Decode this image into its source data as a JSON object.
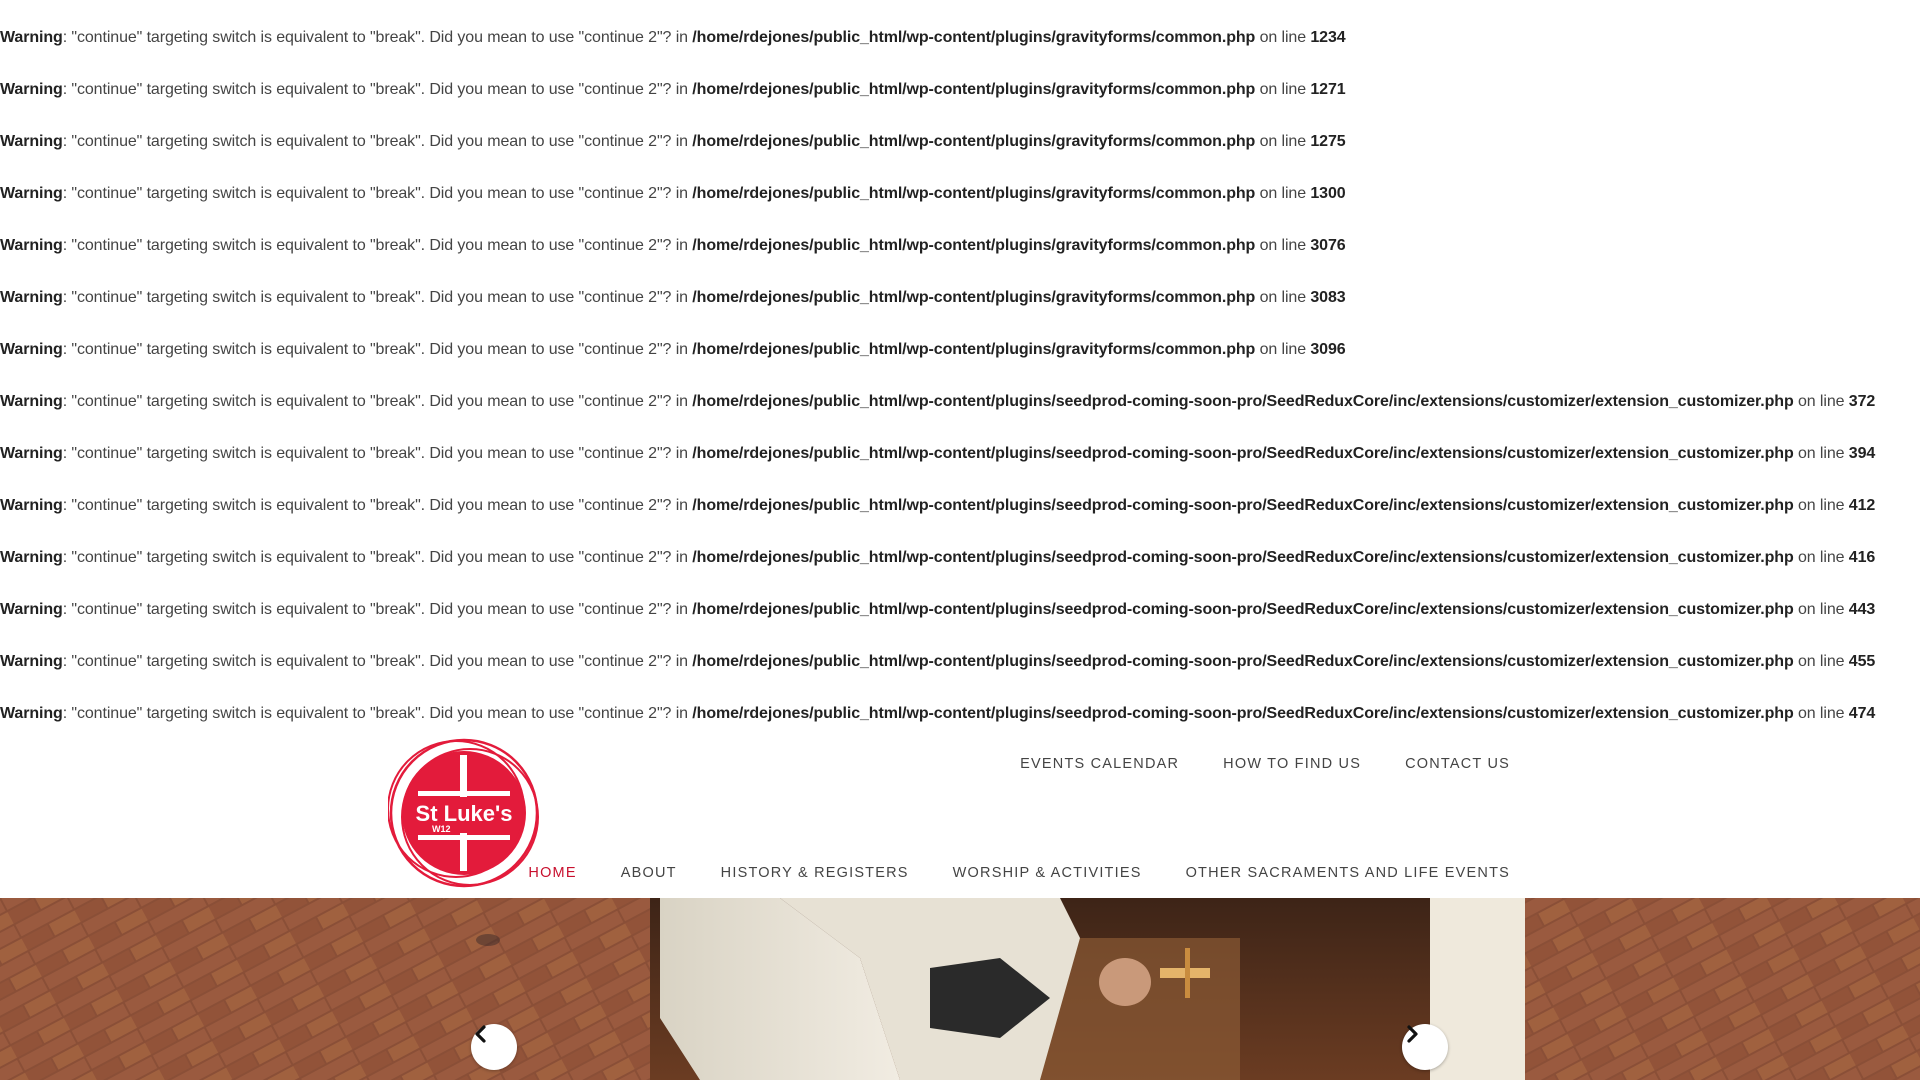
{
  "warnings": [
    {
      "label": "Warning",
      "message": ": \"continue\" targeting switch is equivalent to \"break\". Did you mean to use \"continue 2\"? in ",
      "file": "/home/rdejones/public_html/wp-content/plugins/gravityforms/common.php",
      "on_line": " on line ",
      "line": "1234"
    },
    {
      "label": "Warning",
      "message": ": \"continue\" targeting switch is equivalent to \"break\". Did you mean to use \"continue 2\"? in ",
      "file": "/home/rdejones/public_html/wp-content/plugins/gravityforms/common.php",
      "on_line": " on line ",
      "line": "1271"
    },
    {
      "label": "Warning",
      "message": ": \"continue\" targeting switch is equivalent to \"break\". Did you mean to use \"continue 2\"? in ",
      "file": "/home/rdejones/public_html/wp-content/plugins/gravityforms/common.php",
      "on_line": " on line ",
      "line": "1275"
    },
    {
      "label": "Warning",
      "message": ": \"continue\" targeting switch is equivalent to \"break\". Did you mean to use \"continue 2\"? in ",
      "file": "/home/rdejones/public_html/wp-content/plugins/gravityforms/common.php",
      "on_line": " on line ",
      "line": "1300"
    },
    {
      "label": "Warning",
      "message": ": \"continue\" targeting switch is equivalent to \"break\". Did you mean to use \"continue 2\"? in ",
      "file": "/home/rdejones/public_html/wp-content/plugins/gravityforms/common.php",
      "on_line": " on line ",
      "line": "3076"
    },
    {
      "label": "Warning",
      "message": ": \"continue\" targeting switch is equivalent to \"break\". Did you mean to use \"continue 2\"? in ",
      "file": "/home/rdejones/public_html/wp-content/plugins/gravityforms/common.php",
      "on_line": " on line ",
      "line": "3083"
    },
    {
      "label": "Warning",
      "message": ": \"continue\" targeting switch is equivalent to \"break\". Did you mean to use \"continue 2\"? in ",
      "file": "/home/rdejones/public_html/wp-content/plugins/gravityforms/common.php",
      "on_line": " on line ",
      "line": "3096"
    },
    {
      "label": "Warning",
      "message": ": \"continue\" targeting switch is equivalent to \"break\". Did you mean to use \"continue 2\"? in ",
      "file": "/home/rdejones/public_html/wp-content/plugins/seedprod-coming-soon-pro/SeedReduxCore/inc/extensions/customizer/extension_customizer.php",
      "on_line": " on line ",
      "line": "372"
    },
    {
      "label": "Warning",
      "message": ": \"continue\" targeting switch is equivalent to \"break\". Did you mean to use \"continue 2\"? in ",
      "file": "/home/rdejones/public_html/wp-content/plugins/seedprod-coming-soon-pro/SeedReduxCore/inc/extensions/customizer/extension_customizer.php",
      "on_line": " on line ",
      "line": "394"
    },
    {
      "label": "Warning",
      "message": ": \"continue\" targeting switch is equivalent to \"break\". Did you mean to use \"continue 2\"? in ",
      "file": "/home/rdejones/public_html/wp-content/plugins/seedprod-coming-soon-pro/SeedReduxCore/inc/extensions/customizer/extension_customizer.php",
      "on_line": " on line ",
      "line": "412"
    },
    {
      "label": "Warning",
      "message": ": \"continue\" targeting switch is equivalent to \"break\". Did you mean to use \"continue 2\"? in ",
      "file": "/home/rdejones/public_html/wp-content/plugins/seedprod-coming-soon-pro/SeedReduxCore/inc/extensions/customizer/extension_customizer.php",
      "on_line": " on line ",
      "line": "416"
    },
    {
      "label": "Warning",
      "message": ": \"continue\" targeting switch is equivalent to \"break\". Did you mean to use \"continue 2\"? in ",
      "file": "/home/rdejones/public_html/wp-content/plugins/seedprod-coming-soon-pro/SeedReduxCore/inc/extensions/customizer/extension_customizer.php",
      "on_line": " on line ",
      "line": "443"
    },
    {
      "label": "Warning",
      "message": ": \"continue\" targeting switch is equivalent to \"break\". Did you mean to use \"continue 2\"? in ",
      "file": "/home/rdejones/public_html/wp-content/plugins/seedprod-coming-soon-pro/SeedReduxCore/inc/extensions/customizer/extension_customizer.php",
      "on_line": " on line ",
      "line": "455"
    },
    {
      "label": "Warning",
      "message": ": \"continue\" targeting switch is equivalent to \"break\". Did you mean to use \"continue 2\"? in ",
      "file": "/home/rdejones/public_html/wp-content/plugins/seedprod-coming-soon-pro/SeedReduxCore/inc/extensions/customizer/extension_customizer.php",
      "on_line": " on line ",
      "line": "474"
    }
  ],
  "logo": {
    "text": "St Luke's",
    "subtext": "W12",
    "color": "#e31b3b",
    "icon": "st-lukes-logo"
  },
  "top_nav": {
    "events": "EVENTS CALENDAR",
    "find": "HOW TO FIND US",
    "contact": "CONTACT US"
  },
  "main_nav": {
    "home": "HOME",
    "about": "ABOUT",
    "history": "HISTORY & REGISTERS",
    "worship": "WORSHIP & ACTIVITIES",
    "sacraments": "OTHER SACRAMENTS AND LIFE EVENTS"
  },
  "colors": {
    "accent": "#c8102e",
    "nav_text": "#444444"
  },
  "slider": {
    "prev_icon": "chevron-left-icon",
    "next_icon": "chevron-right-icon"
  }
}
